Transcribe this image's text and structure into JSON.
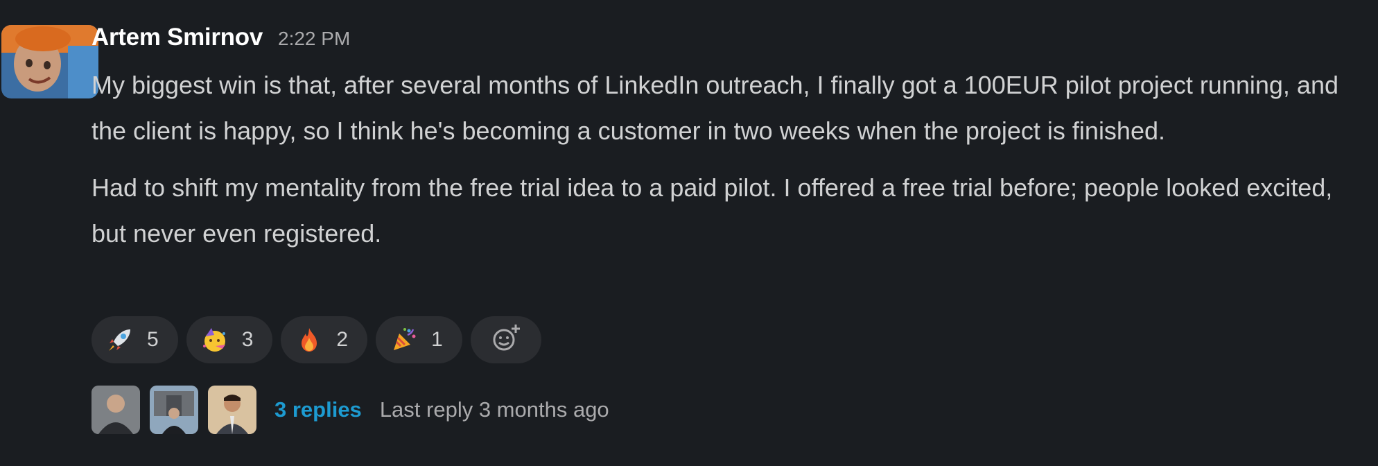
{
  "message": {
    "author": "Artem Smirnov",
    "timestamp": "2:22 PM",
    "paragraphs": [
      "My biggest win is that, after several months of LinkedIn outreach, I finally got a 100EUR pilot project running, and the client is happy, so I think he's becoming a customer in two weeks when the project is finished.",
      "Had to shift my mentality from the free trial idea to a paid pilot. I offered a free trial before; people looked excited, but never even registered."
    ]
  },
  "reactions": [
    {
      "icon": "rocket-icon",
      "count": "5"
    },
    {
      "icon": "partying-face-icon",
      "count": "3"
    },
    {
      "icon": "fire-icon",
      "count": "2"
    },
    {
      "icon": "party-popper-icon",
      "count": "1"
    }
  ],
  "add_reaction_icon": "add-reaction-icon",
  "thread": {
    "replies_label": "3 replies",
    "last_reply": "Last reply 3 months ago"
  },
  "colors": {
    "background": "#1a1d21",
    "text": "#d1d2d3",
    "author": "#ffffff",
    "muted": "#ababad",
    "link": "#1d9bd1",
    "pill": "#2b2d31"
  }
}
